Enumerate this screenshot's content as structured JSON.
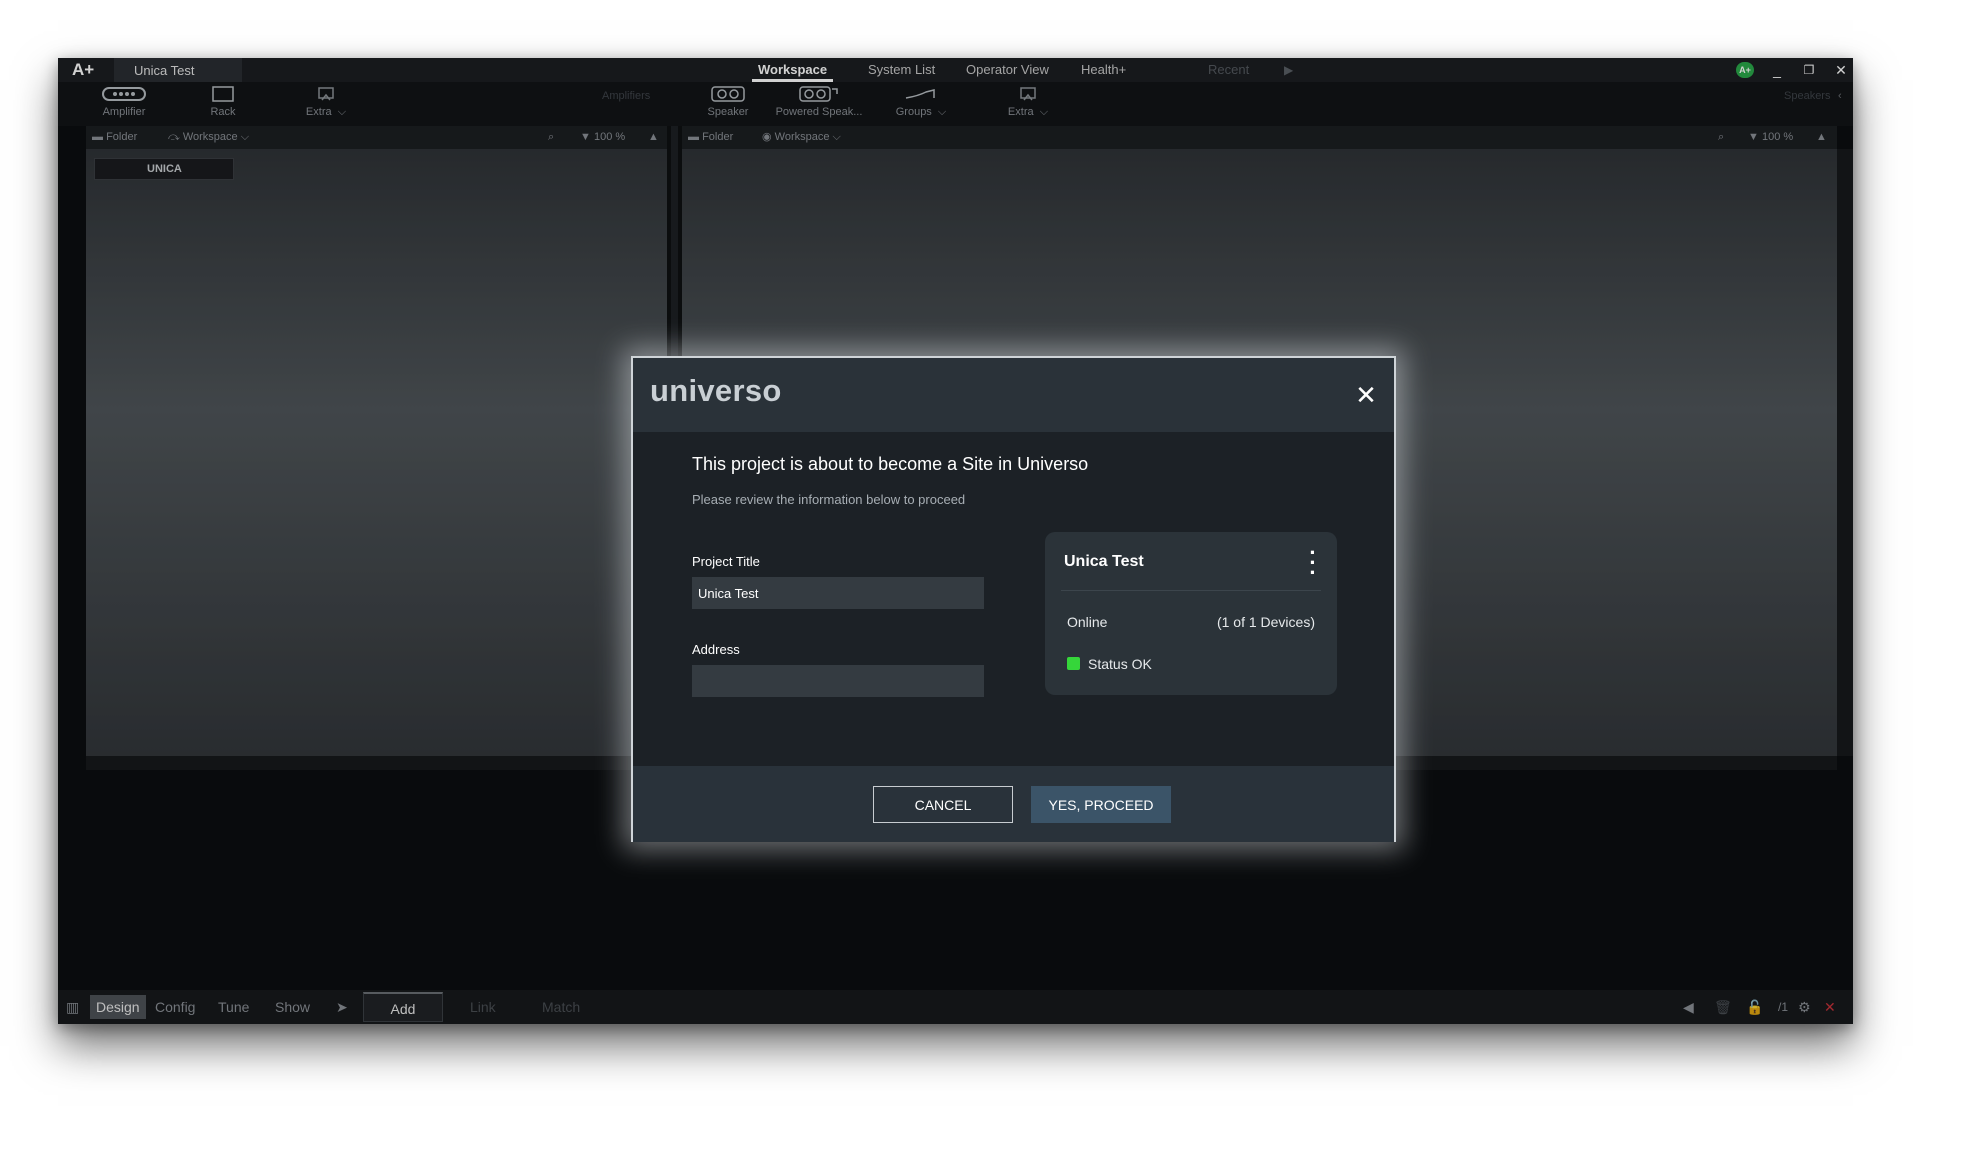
{
  "titlebar": {
    "logo": "A+",
    "window_tab": "Unica Test",
    "nav": [
      "Workspace",
      "System List",
      "Operator View",
      "Health+",
      "Recent"
    ],
    "badge": "A+"
  },
  "toolbar": {
    "left_buttons": [
      {
        "label": "Amplifier",
        "icon": "amplifier-icon"
      },
      {
        "label": "Rack",
        "icon": "rack-icon"
      },
      {
        "label": "Extra",
        "icon": "extra-icon"
      }
    ],
    "left_caption": "Amplifiers",
    "right_buttons": [
      {
        "label": "Speaker",
        "icon": "speaker-icon"
      },
      {
        "label": "Powered Speak...",
        "icon": "powered-speaker-icon"
      },
      {
        "label": "Groups",
        "icon": "groups-icon"
      },
      {
        "label": "Extra",
        "icon": "extra-icon"
      }
    ],
    "right_caption": "Speakers"
  },
  "panels": {
    "folder": "Folder",
    "workspace": "Workspace",
    "zoom": "100 %",
    "device_chip": "UNICA"
  },
  "bottombar": {
    "modes": [
      "Design",
      "Config",
      "Tune",
      "Show"
    ],
    "actions": [
      "Add",
      "Link",
      "Match"
    ],
    "page_count": "/1"
  },
  "dialog": {
    "logo": "universo",
    "title": "This project is about to become a Site in Universo",
    "subtitle": "Please review the information below to proceed",
    "project_title_label": "Project Title",
    "project_title_value": "Unica Test",
    "address_label": "Address",
    "address_value": "",
    "card": {
      "title": "Unica Test",
      "online_label": "Online",
      "devices": "(1 of 1 Devices)",
      "status": "Status OK",
      "status_color": "#35d63a"
    },
    "cancel_label": "CANCEL",
    "proceed_label": "YES, PROCEED"
  }
}
